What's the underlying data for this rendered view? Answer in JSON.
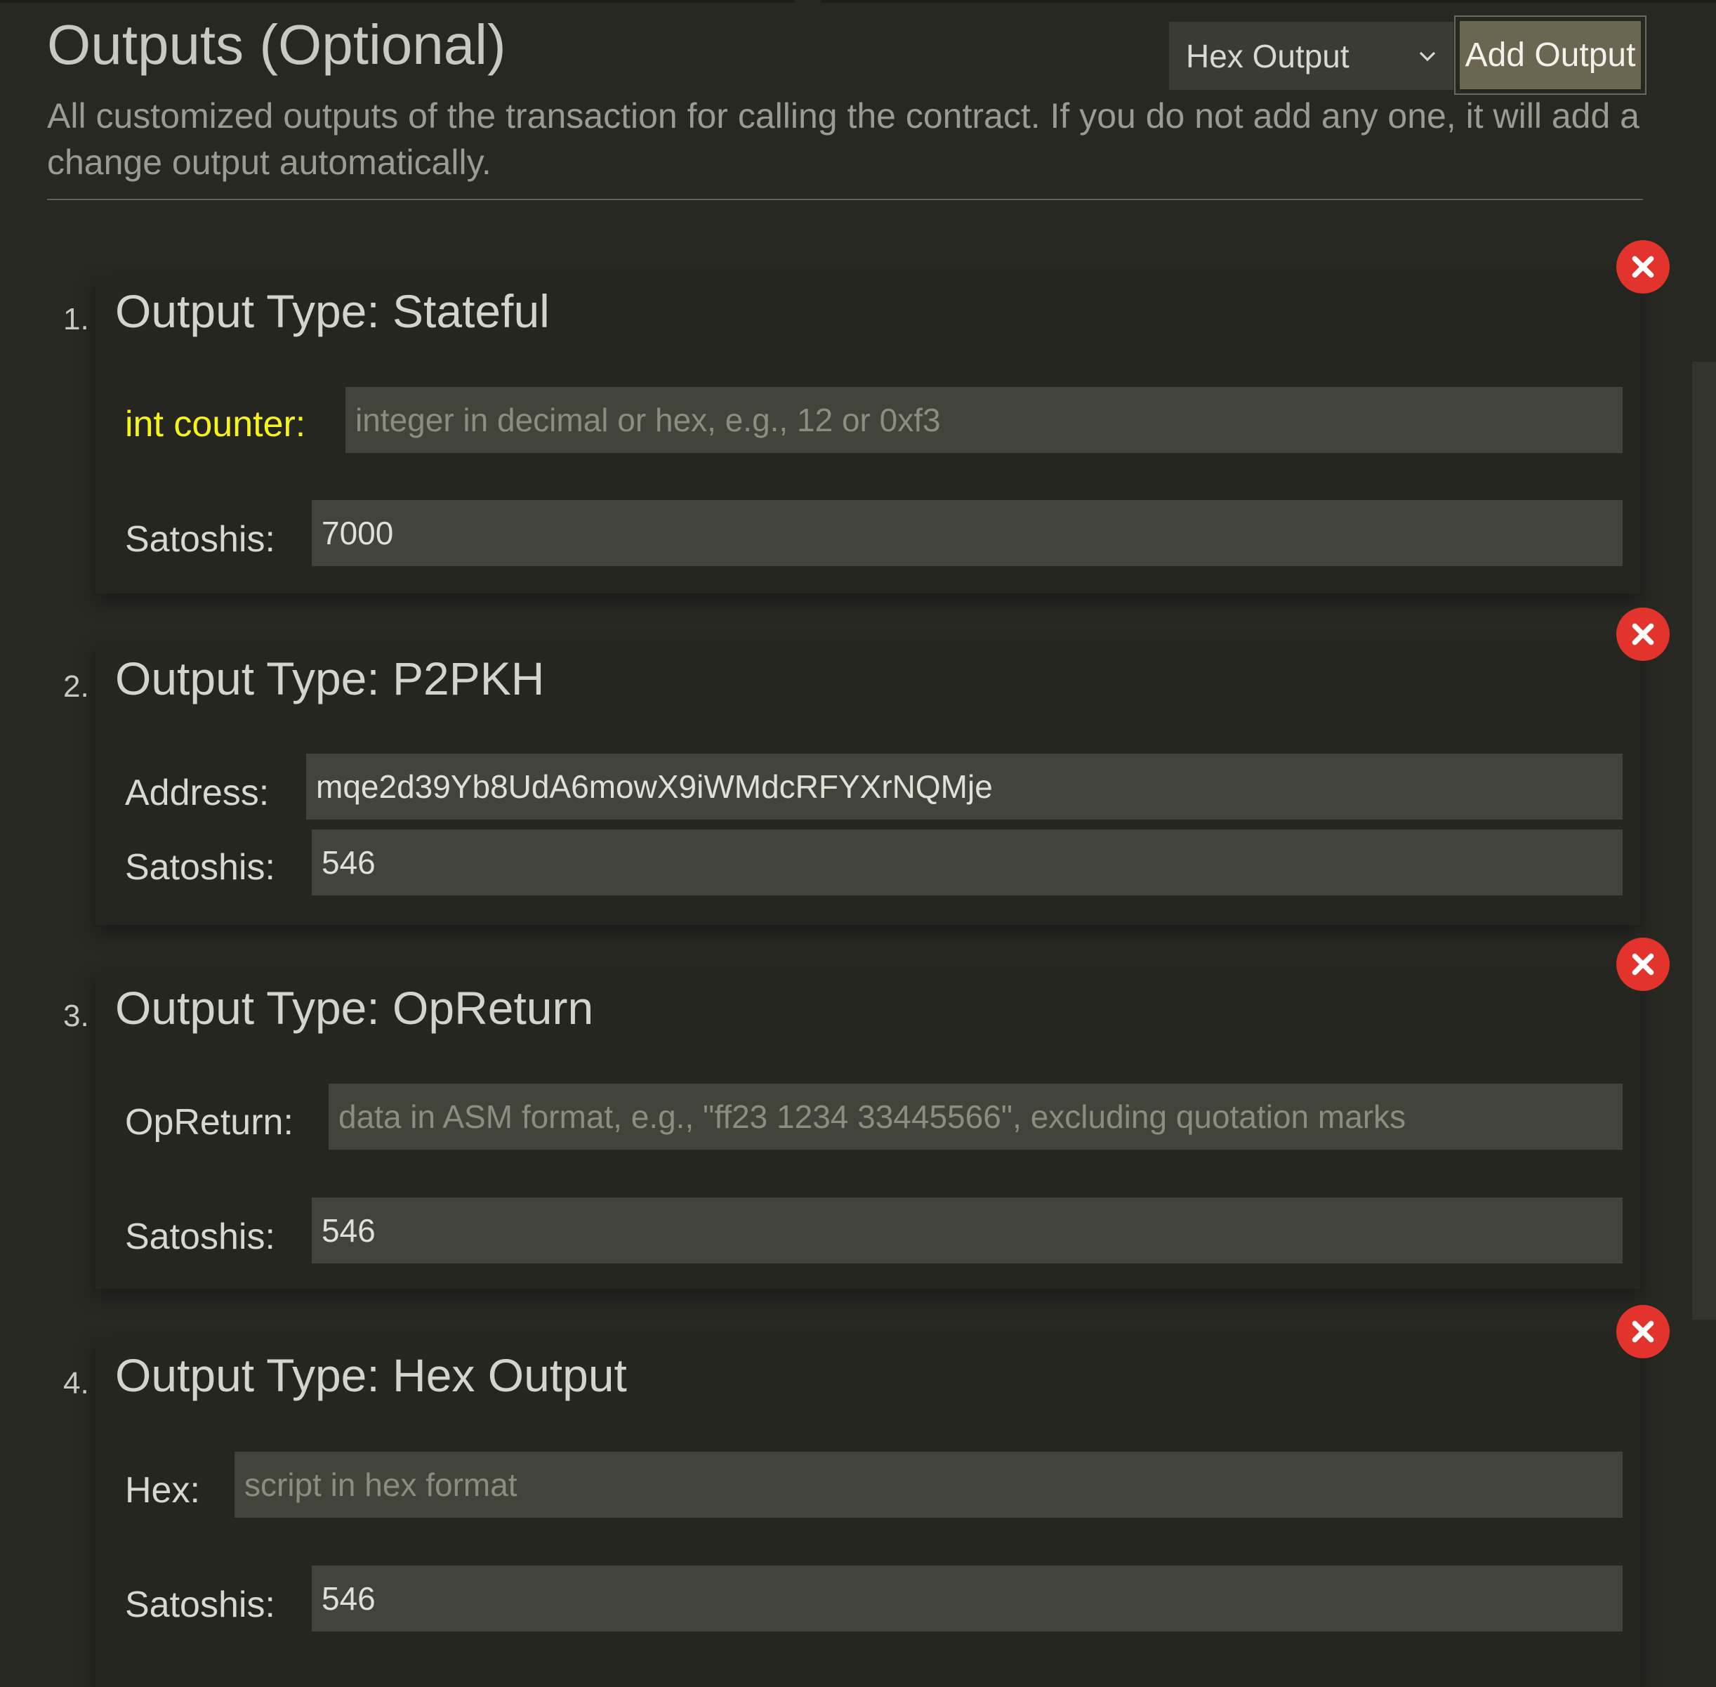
{
  "header": {
    "title": "Outputs (Optional)",
    "type_select": {
      "selected": "Hex Output"
    },
    "add_button": "Add Output",
    "description": "All customized outputs of the transaction for calling the contract. If you do not add any one, it will add a change output automatically."
  },
  "outputs": [
    {
      "number": "1.",
      "title": "Output Type: Stateful",
      "fields": [
        {
          "label": "int counter:",
          "value": "",
          "placeholder": "integer in decimal or hex, e.g., 12 or 0xf3"
        },
        {
          "label": "Satoshis:",
          "value": "7000",
          "placeholder": ""
        }
      ]
    },
    {
      "number": "2.",
      "title": "Output Type: P2PKH",
      "fields": [
        {
          "label": "Address:",
          "value": "mqe2d39Yb8UdA6mowX9iWMdcRFYXrNQMje",
          "placeholder": ""
        },
        {
          "label": "Satoshis:",
          "value": "546",
          "placeholder": ""
        }
      ]
    },
    {
      "number": "3.",
      "title": "Output Type: OpReturn",
      "fields": [
        {
          "label": "OpReturn:",
          "value": "",
          "placeholder": "data in ASM format, e.g., \"ff23 1234 33445566\", excluding quotation marks"
        },
        {
          "label": "Satoshis:",
          "value": "546",
          "placeholder": ""
        }
      ]
    },
    {
      "number": "4.",
      "title": "Output Type: Hex Output",
      "fields": [
        {
          "label": "Hex:",
          "value": "",
          "placeholder": "script in hex format"
        },
        {
          "label": "Satoshis:",
          "value": "546",
          "placeholder": ""
        }
      ]
    }
  ],
  "icons": {
    "remove": "close-circle-icon",
    "dropdown": "chevron-down-icon"
  },
  "colors": {
    "background": "#272822",
    "field_background": "#42433a",
    "label_highlight": "#f7f41a",
    "remove_button": "#e2332c",
    "add_button": "#6a6652"
  }
}
